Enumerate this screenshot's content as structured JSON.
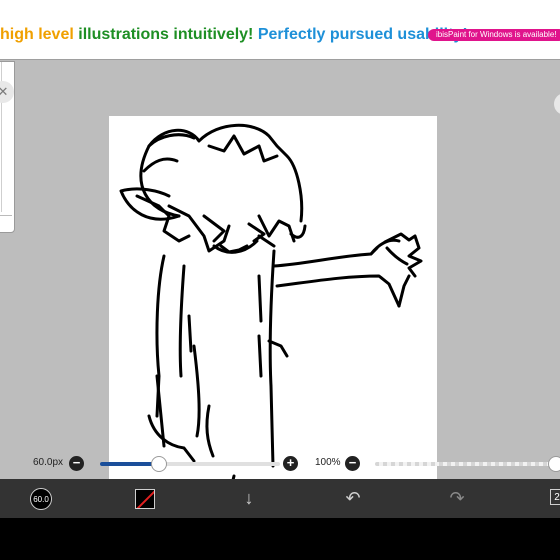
{
  "banner": {
    "segments": [
      "high level ",
      "illustrations ",
      "intuitively! ",
      "Perfectly pursued usability!"
    ],
    "badge": "ibisPaint for Windows is available!"
  },
  "sliders": {
    "brush_size": "60.0px",
    "minus": "−",
    "plus": "+",
    "brush_size_fraction": 0.33,
    "opacity": "100%",
    "opacity_fraction": 1.0
  },
  "toolbar": {
    "brush_label": "60.0",
    "layers_count": "2",
    "icons": [
      "brush-size-icon",
      "color-swatch-icon",
      "down-arrow-icon",
      "undo-icon",
      "redo-icon",
      "layers-icon"
    ]
  },
  "colors": {
    "toolbar_bg": "#333333",
    "slider_accent": "#1b4f9a",
    "workspace_bg": "#bdbdbd",
    "banner_badge": "#e0148c"
  }
}
